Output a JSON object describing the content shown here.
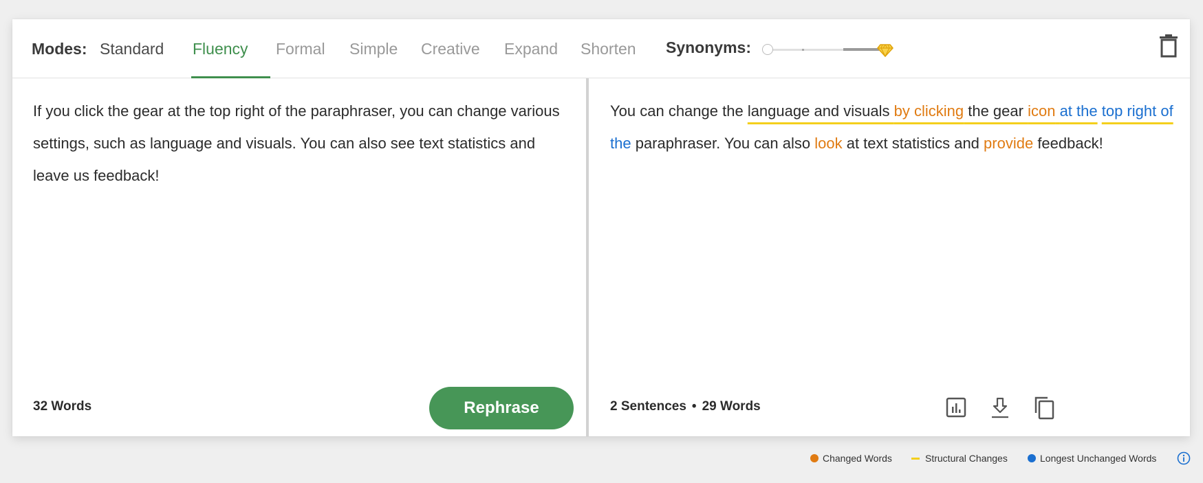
{
  "header": {
    "modes_label": "Modes:",
    "tabs": [
      {
        "label": "Standard",
        "state": "available"
      },
      {
        "label": "Fluency",
        "state": "active"
      },
      {
        "label": "Formal",
        "state": "locked"
      },
      {
        "label": "Simple",
        "state": "locked"
      },
      {
        "label": "Creative",
        "state": "locked"
      },
      {
        "label": "Expand",
        "state": "locked"
      },
      {
        "label": "Shorten",
        "state": "locked"
      }
    ],
    "synonyms_label": "Synonyms:",
    "synonyms_level": 0,
    "delete_icon": "trash-icon"
  },
  "input": {
    "text": "If you click the gear at the top right of the paraphraser, you can change various settings, such as language and visuals. You can also see text statistics and leave us feedback!",
    "word_count": "32 Words",
    "rephrase_label": "Rephrase"
  },
  "output": {
    "segments": [
      {
        "text": "You can change the ",
        "type": "plain"
      },
      {
        "text": "language and visuals ",
        "type": "plain",
        "structural": true
      },
      {
        "text": "by clicking",
        "type": "changed",
        "structural": true
      },
      {
        "text": " the gear ",
        "type": "plain",
        "structural": true
      },
      {
        "text": "icon",
        "type": "changed",
        "structural": true
      },
      {
        "text": " ",
        "type": "plain",
        "structural": true
      },
      {
        "text": "at the",
        "type": "longest",
        "structural": true
      },
      {
        "text": " ",
        "type": "plain"
      },
      {
        "text": "top right of",
        "type": "longest",
        "structural": true
      },
      {
        "text": " the",
        "type": "longest"
      },
      {
        "text": " paraphraser. You can also ",
        "type": "plain"
      },
      {
        "text": "look",
        "type": "changed"
      },
      {
        "text": " at text statistics and ",
        "type": "plain"
      },
      {
        "text": "provide",
        "type": "changed"
      },
      {
        "text": " feedback!",
        "type": "plain"
      }
    ],
    "sentences": "2 Sentences",
    "separator": "•",
    "words": "29 Words",
    "actions": [
      "stats-icon",
      "download-icon",
      "copy-icon"
    ]
  },
  "legend": {
    "changed": {
      "label": "Changed Words",
      "color": "#e07b12"
    },
    "structural": {
      "label": "Structural Changes",
      "color": "#f4cf1c"
    },
    "longest": {
      "label": "Longest Unchanged Words",
      "color": "#1a6fd0"
    }
  },
  "colors": {
    "accent": "#3f8f4d",
    "button": "#479657"
  }
}
